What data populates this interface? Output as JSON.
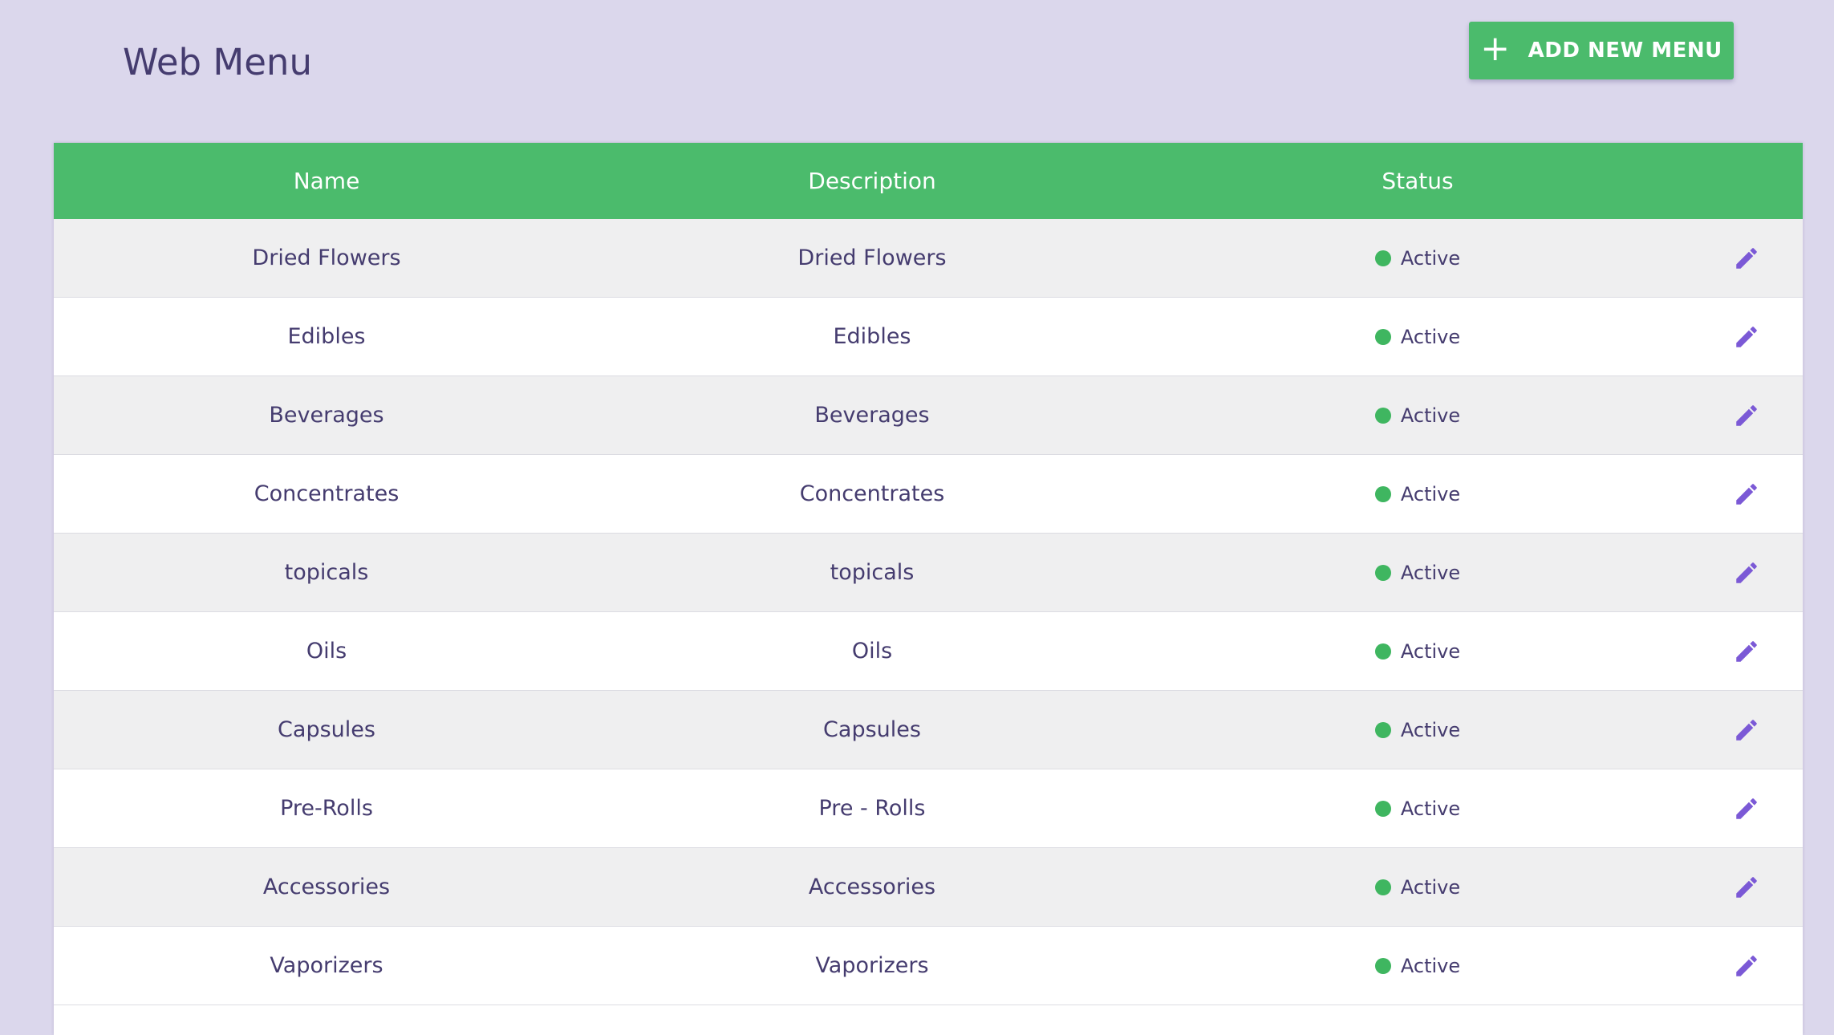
{
  "page": {
    "title": "Web Menu"
  },
  "toolbar": {
    "add_button_label": "ADD NEW MENU",
    "add_icon": "plus-icon"
  },
  "table": {
    "columns": [
      "Name",
      "Description",
      "Status"
    ],
    "rows": [
      {
        "name": "Dried Flowers",
        "description": "Dried Flowers",
        "status": "Active"
      },
      {
        "name": "Edibles",
        "description": "Edibles",
        "status": "Active"
      },
      {
        "name": "Beverages",
        "description": "Beverages",
        "status": "Active"
      },
      {
        "name": "Concentrates",
        "description": "Concentrates",
        "status": "Active"
      },
      {
        "name": "topicals",
        "description": "topicals",
        "status": "Active"
      },
      {
        "name": "Oils",
        "description": "Oils",
        "status": "Active"
      },
      {
        "name": "Capsules",
        "description": "Capsules",
        "status": "Active"
      },
      {
        "name": "Pre-Rolls",
        "description": "Pre - Rolls",
        "status": "Active"
      },
      {
        "name": "Accessories",
        "description": "Accessories",
        "status": "Active"
      },
      {
        "name": "Vaporizers",
        "description": "Vaporizers",
        "status": "Active"
      }
    ],
    "row_action_icon": "pencil-edit-icon"
  },
  "colors": {
    "background": "#dbd7ec",
    "accent_green": "#4bbb6c",
    "status_active": "#3fb660",
    "text": "#453c6f",
    "edit_icon": "#7b59d6",
    "row_alt": "#efeff0"
  }
}
